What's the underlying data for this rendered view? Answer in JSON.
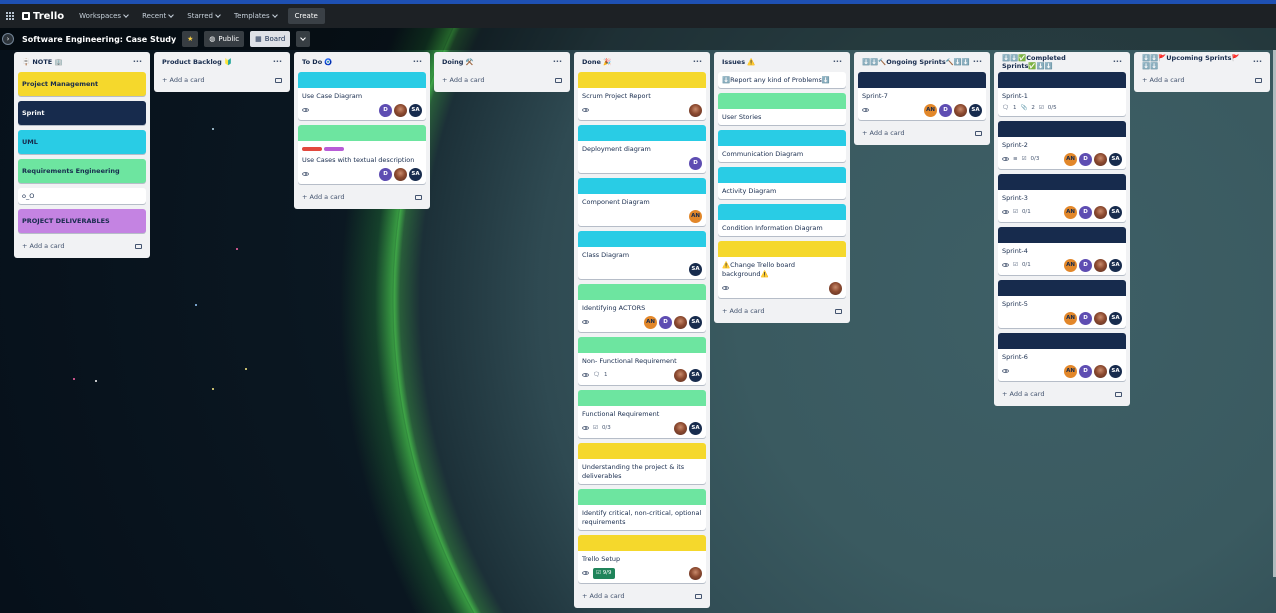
{
  "topbar": {
    "logo": "Trello",
    "nav": [
      "Workspaces",
      "Recent",
      "Starred",
      "Templates"
    ],
    "create": "Create"
  },
  "board": {
    "title": "Software Engineering: Case Study",
    "visibility": "Public",
    "view": "Board"
  },
  "add_card": "+ Add a card",
  "lists": {
    "note": {
      "title": "🪧 NOTE 🏢",
      "labels": [
        {
          "text": "Project Management",
          "color": "#f5d82c"
        },
        {
          "text": "Sprint",
          "color": "#172b4d",
          "text_color": "#ffffff"
        },
        {
          "text": "UML",
          "color": "#29cce5"
        },
        {
          "text": "Requirements Engineering",
          "color": "#6de5a0"
        },
        {
          "text": "o_O",
          "color": "#ffffff"
        },
        {
          "text": "PROJECT DELIVERABLES",
          "color": "#c483e2"
        }
      ]
    },
    "backlog": {
      "title": "Product Backlog 🔰"
    },
    "todo": {
      "title": "To Do 🧿",
      "cards": [
        {
          "title": "Use Case Diagram",
          "cover": "#29cce5"
        },
        {
          "title": "Use Cases with textual description",
          "cover": "#6de5a0"
        }
      ]
    },
    "doing": {
      "title": "Doing ⚒️"
    },
    "done": {
      "title": "Done 🎉",
      "cards": [
        {
          "title": "Scrum Project Report",
          "cover": "#f5d82c"
        },
        {
          "title": "Deployment diagram",
          "cover": "#29cce5"
        },
        {
          "title": "Component Diagram",
          "cover": "#29cce5"
        },
        {
          "title": "Class Diagram",
          "cover": "#29cce5"
        },
        {
          "title": "Identifying ACTORS",
          "cover": "#6de5a0"
        },
        {
          "title": "Non- Functional Requirement",
          "cover": "#6de5a0",
          "comments": "1"
        },
        {
          "title": "Functional Requirement",
          "cover": "#6de5a0",
          "checklist": "0/3"
        },
        {
          "title": "Understanding the project & its deliverables",
          "cover": "#f5d82c"
        },
        {
          "title": "Identify critical, non-critical, optional requirements",
          "cover": "#6de5a0"
        },
        {
          "title": "Trello Setup",
          "cover": "#f5d82c",
          "checklist": "9/9"
        }
      ]
    },
    "issues": {
      "title": "Issues ⚠️",
      "cards": [
        {
          "title": "⬇️Report any kind of Problems⬇️",
          "cover": ""
        },
        {
          "title": "User Stories",
          "cover": "#6de5a0"
        },
        {
          "title": "Communication Diagram",
          "cover": "#29cce5"
        },
        {
          "title": "Activity Diagram",
          "cover": "#29cce5"
        },
        {
          "title": "Condition Information Diagram",
          "cover": "#29cce5"
        },
        {
          "title": "⚠️Change Trello board background⚠️",
          "cover": "#f5d82c"
        }
      ]
    },
    "ongoing": {
      "title": "⬇️⬇️🔨Ongoing Sprints🔨⬇️⬇️",
      "cards": [
        {
          "title": "Sprint-7",
          "cover": "#172b4d"
        }
      ]
    },
    "completed": {
      "title": "⬇️⬇️✅Completed Sprints✅⬇️⬇️",
      "cards": [
        {
          "title": "Sprint-1",
          "cover": "#172b4d",
          "comments": "1",
          "attachments": "2",
          "checklist": "0/5"
        },
        {
          "title": "Sprint-2",
          "cover": "#172b4d",
          "checklist": "0/3"
        },
        {
          "title": "Sprint-3",
          "cover": "#172b4d",
          "checklist": "0/1"
        },
        {
          "title": "Sprint-4",
          "cover": "#172b4d",
          "checklist": "0/1"
        },
        {
          "title": "Sprint-5",
          "cover": "#172b4d"
        },
        {
          "title": "Sprint-6",
          "cover": "#172b4d"
        }
      ]
    },
    "upcoming": {
      "title": "⬇️⬇️🚩Upcoming Sprints🚩⬇️⬇️"
    }
  },
  "avatars": {
    "d": "D",
    "an": "AN",
    "sa": "SA"
  }
}
